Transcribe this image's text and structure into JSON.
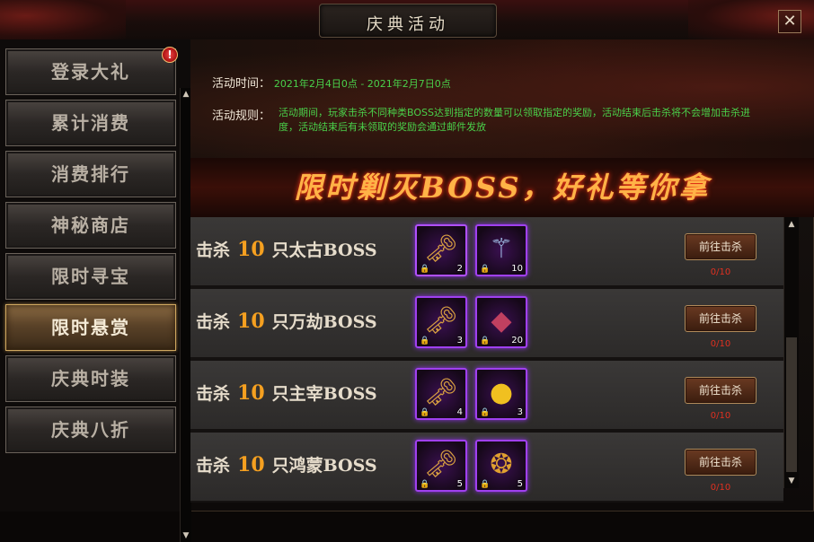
{
  "window": {
    "title": "庆典活动",
    "close_symbol": "✕"
  },
  "sidebar": {
    "alert_symbol": "!",
    "items": [
      {
        "label": "登录大礼",
        "active": false
      },
      {
        "label": "累计消费",
        "active": false
      },
      {
        "label": "消费排行",
        "active": false
      },
      {
        "label": "神秘商店",
        "active": false
      },
      {
        "label": "限时寻宝",
        "active": false
      },
      {
        "label": "限时悬赏",
        "active": true
      },
      {
        "label": "庆典时装",
        "active": false
      },
      {
        "label": "庆典八折",
        "active": false
      }
    ]
  },
  "banner": {
    "time_label": "活动时间：",
    "time_value": "2021年2月4日0点 - 2021年2月7日0点",
    "rules_label": "活动规则：",
    "rules_value": "活动期间，玩家击杀不同种类BOSS达到指定的数量可以领取指定的奖励，活动结束后击杀将不会增加击杀进度，活动结束后有未领取的奖励会通过邮件发放",
    "headline": "限时剿灭BOSS，好礼等你拿"
  },
  "rows": [
    {
      "prefix": "击杀",
      "count": "10",
      "suffix": "只太古BOSS",
      "rewards": [
        {
          "icon": "key-icon",
          "glyph": "🗝",
          "qty": "2"
        },
        {
          "icon": "staff-icon",
          "glyph": "⚚",
          "qty": "10"
        }
      ],
      "button": "前往击杀",
      "progress": "0/10"
    },
    {
      "prefix": "击杀",
      "count": "10",
      "suffix": "只万劫BOSS",
      "rewards": [
        {
          "icon": "key-icon",
          "glyph": "🗝",
          "qty": "3"
        },
        {
          "icon": "crystal-icon",
          "glyph": "◆",
          "qty": "20"
        }
      ],
      "button": "前往击杀",
      "progress": "0/10"
    },
    {
      "prefix": "击杀",
      "count": "10",
      "suffix": "只主宰BOSS",
      "rewards": [
        {
          "icon": "key-icon",
          "glyph": "🗝",
          "qty": "4"
        },
        {
          "icon": "orb-icon",
          "glyph": "●",
          "qty": "3"
        }
      ],
      "button": "前往击杀",
      "progress": "0/10"
    },
    {
      "prefix": "击杀",
      "count": "10",
      "suffix": "只鸿蒙BOSS",
      "rewards": [
        {
          "icon": "key-icon",
          "glyph": "🗝",
          "qty": "5"
        },
        {
          "icon": "gem-icon",
          "glyph": "❂",
          "qty": "5"
        }
      ],
      "button": "前往击杀",
      "progress": "0/10"
    }
  ],
  "colors": {
    "accent_gold": "#f5a020",
    "progress_red": "#e03020",
    "info_green": "#4ad04a",
    "item_border": "#a040f0"
  }
}
